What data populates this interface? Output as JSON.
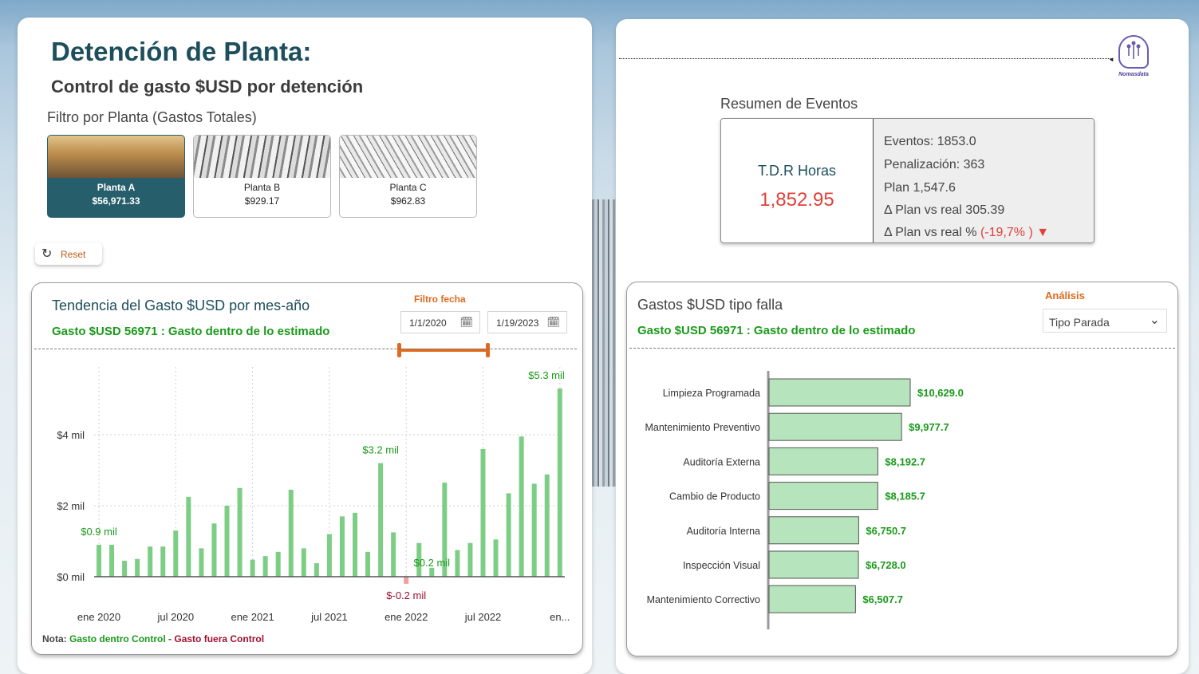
{
  "header": {
    "title": "Detención de Planta:",
    "subtitle": "Control de gasto $USD por detención",
    "filter_label": "Filtro por Planta (Gastos Totales)"
  },
  "plants": [
    {
      "name": "Planta A",
      "value": "$56,971.33",
      "selected": true
    },
    {
      "name": "Planta B",
      "value": "$929.17",
      "selected": false
    },
    {
      "name": "Planta C",
      "value": "$962.83",
      "selected": false
    }
  ],
  "reset": {
    "icon": "refresh-icon",
    "label": "Reset"
  },
  "trend": {
    "title": "Tendencia del Gasto $USD por mes-año",
    "note": "Gasto $USD 56971 : Gasto dentro de lo estimado",
    "date_filter_label": "Filtro fecha",
    "date_start": "1/1/2020",
    "date_end": "1/19/2023",
    "footer_prefix": "Nota:",
    "footer_in": "Gasto dentro Control",
    "footer_sep": " - ",
    "footer_out": "Gasto fuera Control"
  },
  "chart_data": [
    {
      "type": "bar",
      "title": "Tendencia del Gasto $USD por mes-año",
      "y_unit": "mil USD",
      "ylim": [
        -0.5,
        5.5
      ],
      "y_ticks": [
        {
          "value": 0,
          "label": "$0 mil"
        },
        {
          "value": 2,
          "label": "$2 mil"
        },
        {
          "value": 4,
          "label": "$4 mil"
        }
      ],
      "x_ticks": [
        {
          "index": 0,
          "label": "ene 2020"
        },
        {
          "index": 6,
          "label": "jul 2020"
        },
        {
          "index": 12,
          "label": "ene 2021"
        },
        {
          "index": 18,
          "label": "jul 2021"
        },
        {
          "index": 24,
          "label": "ene 2022"
        },
        {
          "index": 30,
          "label": "jul 2022"
        },
        {
          "index": 36,
          "label": "en..."
        }
      ],
      "values": [
        0.9,
        0.9,
        0.45,
        0.5,
        0.85,
        0.85,
        1.3,
        2.25,
        0.8,
        1.5,
        2.0,
        2.5,
        0.48,
        0.58,
        0.7,
        2.45,
        0.8,
        0.38,
        1.2,
        1.7,
        1.8,
        0.7,
        3.2,
        1.25,
        -0.2,
        0.95,
        0.25,
        2.65,
        0.75,
        0.95,
        3.6,
        1.05,
        2.35,
        3.95,
        2.62,
        2.88,
        5.3
      ],
      "data_labels": [
        {
          "index": 0,
          "label": "$0.9 mil"
        },
        {
          "index": 22,
          "label": "$3.2 mil"
        },
        {
          "index": 24,
          "label": "$-0.2 mil"
        },
        {
          "index": 26,
          "label": "$0.2 mil"
        },
        {
          "index": 36,
          "label": "$5.3 mil"
        }
      ],
      "colors": {
        "positive": "#7dce85",
        "negative": "#f0a0a0",
        "label_positive": "#1a9a1a",
        "label_negative": "#a01030"
      },
      "grid": true
    },
    {
      "type": "bar",
      "orientation": "horizontal",
      "title": "Gastos $USD tipo falla",
      "categories": [
        "Limpieza Programada",
        "Mantenimiento Preventivo",
        "Auditoría Externa",
        "Cambio de Producto",
        "Auditoría Interna",
        "Inspección Visual",
        "Mantenimiento Correctivo"
      ],
      "values": [
        10629.0,
        9977.7,
        8192.7,
        8185.7,
        6750.7,
        6728.0,
        6507.7
      ],
      "labels": [
        "$10,629.0",
        "$9,977.7",
        "$8,192.7",
        "$8,185.7",
        "$6,750.7",
        "$6,728.0",
        "$6,507.7"
      ],
      "colors": {
        "bar": "#b6e4bc",
        "bar_border": "#555555",
        "label": "#1a9a1a"
      }
    }
  ],
  "logo": {
    "icon": "brain-circuit-icon",
    "text": "Nomasdata"
  },
  "events": {
    "title": "Resumen de Eventos",
    "tdr_label": "T.D.R Horas",
    "tdr_value": "1,852.95",
    "lines": [
      "Eventos: 1853.0",
      "Penalización: 363",
      "Plan 1,547.6",
      "Δ Plan vs real 305.39"
    ],
    "pct_prefix": "Δ Plan vs real %",
    "pct_value": "(-19,7% )",
    "pct_icon": "triangle-down-icon"
  },
  "failures": {
    "title": "Gastos $USD tipo falla",
    "note": "Gasto $USD 56971 : Gasto dentro de lo estimado",
    "analysis_label": "Análisis",
    "select_value": "Tipo Parada"
  }
}
